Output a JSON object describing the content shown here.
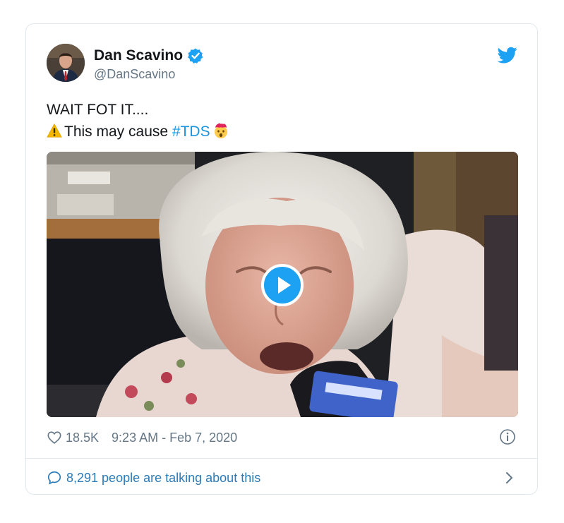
{
  "author": {
    "display_name": "Dan Scavino",
    "handle": "@DanScavino",
    "verified": true
  },
  "tweet": {
    "line1": "WAIT FOT IT....",
    "line2_text": "This may cause ",
    "hashtag": "#TDS",
    "line2_prefix_icon": "warning-icon",
    "line2_suffix_icon": "exploding-head-icon"
  },
  "media": {
    "type": "video",
    "play_icon": "play-icon"
  },
  "meta": {
    "likes": "18.5K",
    "timestamp": "9:23 AM - Feb 7, 2020"
  },
  "footer": {
    "talking": "8,291 people are talking about this"
  },
  "colors": {
    "accent": "#1da1f2",
    "link": "#2b7bb9",
    "secondary_text": "#657786",
    "border": "#e1e8ed"
  }
}
